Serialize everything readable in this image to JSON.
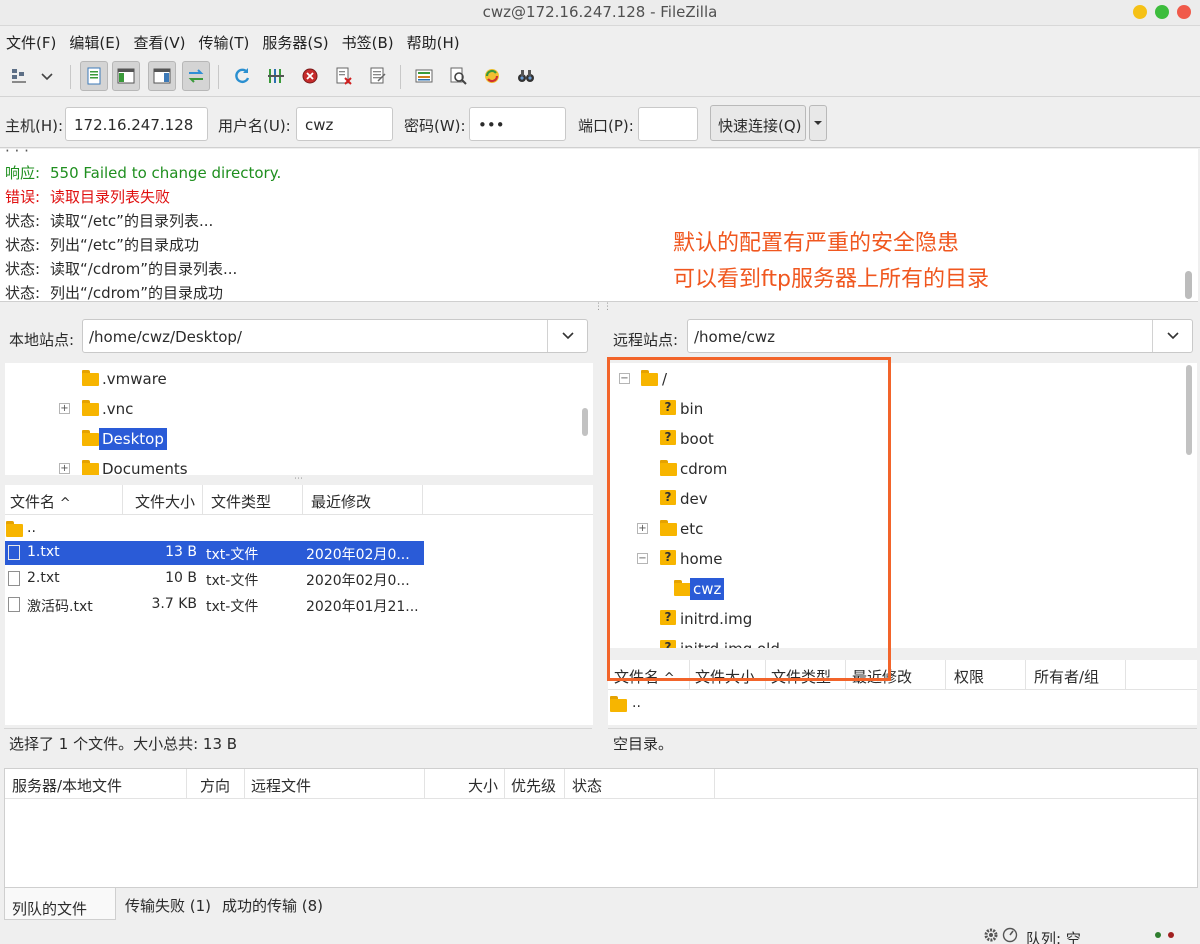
{
  "window": {
    "title": "cwz@172.16.247.128 - FileZilla"
  },
  "colors": {
    "accent": "#2a5bd7",
    "annotation": "#f0571f",
    "log_ok": "#1f8f1f",
    "log_error": "#e01010",
    "highlight_box": "#f2642a"
  },
  "menu": [
    "文件(F)",
    "编辑(E)",
    "查看(V)",
    "传输(T)",
    "服务器(S)",
    "书签(B)",
    "帮助(H)"
  ],
  "toolbar": {
    "icons": [
      "site-manager-icon",
      "dropdown-arrow-icon",
      "toggle-message-log-icon",
      "toggle-local-tree-icon",
      "toggle-remote-tree-icon",
      "toggle-transfer-queue-icon",
      "refresh-icon",
      "process-queue-icon",
      "cancel-icon",
      "disconnect-icon",
      "reconnect-icon",
      "directory-listing-filters-icon",
      "toggle-directory-comparison-icon",
      "synchronized-browsing-icon",
      "search-remote-files-icon"
    ]
  },
  "quickconnect": {
    "host_label": "主机(H):",
    "host": "172.16.247.128",
    "user_label": "用户名(U):",
    "user": "cwz",
    "pass_label": "密码(W):",
    "pass": "•••",
    "port_label": "端口(P):",
    "port": "",
    "button": "快速连接(Q)"
  },
  "log": [
    {
      "label": "响应:",
      "text": "550 Failed to change directory.",
      "kind": "ok"
    },
    {
      "label": "错误:",
      "text": "读取目录列表失败",
      "kind": "error"
    },
    {
      "label": "状态:",
      "text": "读取“/etc”的目录列表...",
      "kind": "normal"
    },
    {
      "label": "状态:",
      "text": "列出“/etc”的目录成功",
      "kind": "normal"
    },
    {
      "label": "状态:",
      "text": "读取“/cdrom”的目录列表...",
      "kind": "normal"
    },
    {
      "label": "状态:",
      "text": "列出“/cdrom”的目录成功",
      "kind": "normal"
    }
  ],
  "annotation": {
    "line1": "默认的配置有严重的安全隐患",
    "line2": "可以看到ftp服务器上所有的目录"
  },
  "local": {
    "site_label": "本地站点:",
    "path": "/home/cwz/Desktop/",
    "tree": [
      {
        "name": ".vmware",
        "expander": "",
        "selected": false
      },
      {
        "name": ".vnc",
        "expander": "+",
        "selected": false
      },
      {
        "name": "Desktop",
        "expander": "",
        "selected": true
      },
      {
        "name": "Documents",
        "expander": "+",
        "selected": false
      }
    ],
    "columns": [
      "文件名",
      "文件大小",
      "文件类型",
      "最近修改"
    ],
    "sort_indicator": "^",
    "files": [
      {
        "name": "..",
        "size": "",
        "type": "",
        "modified": "",
        "kind": "folder",
        "selected": false
      },
      {
        "name": "1.txt",
        "size": "13 B",
        "type": "txt-文件",
        "modified": "2020年02月0...",
        "kind": "file",
        "selected": true
      },
      {
        "name": "2.txt",
        "size": "10 B",
        "type": "txt-文件",
        "modified": "2020年02月0...",
        "kind": "file",
        "selected": false
      },
      {
        "name": "激活码.txt",
        "size": "3.7 KB",
        "type": "txt-文件",
        "modified": "2020年01月21...",
        "kind": "file",
        "selected": false
      }
    ],
    "status": "选择了 1 个文件。大小总共: 13 B"
  },
  "remote": {
    "site_label": "远程站点:",
    "path": "/home/cwz",
    "tree": [
      {
        "name": "/",
        "expander": "−",
        "icon": "folder",
        "selected": false
      },
      {
        "name": "bin",
        "expander": "",
        "icon": "unknown",
        "selected": false
      },
      {
        "name": "boot",
        "expander": "",
        "icon": "unknown",
        "selected": false
      },
      {
        "name": "cdrom",
        "expander": "",
        "icon": "folder",
        "selected": false
      },
      {
        "name": "dev",
        "expander": "",
        "icon": "unknown",
        "selected": false
      },
      {
        "name": "etc",
        "expander": "+",
        "icon": "folder",
        "selected": false
      },
      {
        "name": "home",
        "expander": "−",
        "icon": "unknown",
        "selected": false
      },
      {
        "name": "cwz",
        "expander": "",
        "icon": "folder",
        "selected": true
      },
      {
        "name": "initrd.img",
        "expander": "",
        "icon": "unknown",
        "selected": false
      },
      {
        "name": "initrd.img.old",
        "expander": "",
        "icon": "unknown",
        "selected": false
      }
    ],
    "columns": [
      "文件名",
      "文件大小",
      "文件类型",
      "最近修改",
      "权限",
      "所有者/组"
    ],
    "sort_indicator": "^",
    "files": [
      {
        "name": "..",
        "kind": "folder"
      }
    ],
    "status": "空目录。"
  },
  "queue": {
    "columns": [
      "服务器/本地文件",
      "方向",
      "远程文件",
      "大小",
      "优先级",
      "状态"
    ]
  },
  "tabs": [
    {
      "label": "列队的文件",
      "active": true
    },
    {
      "label": "传输失败 (1)",
      "active": false
    },
    {
      "label": "成功的传输 (8)",
      "active": false
    }
  ],
  "statusbar": {
    "queue": "队列: 空"
  }
}
